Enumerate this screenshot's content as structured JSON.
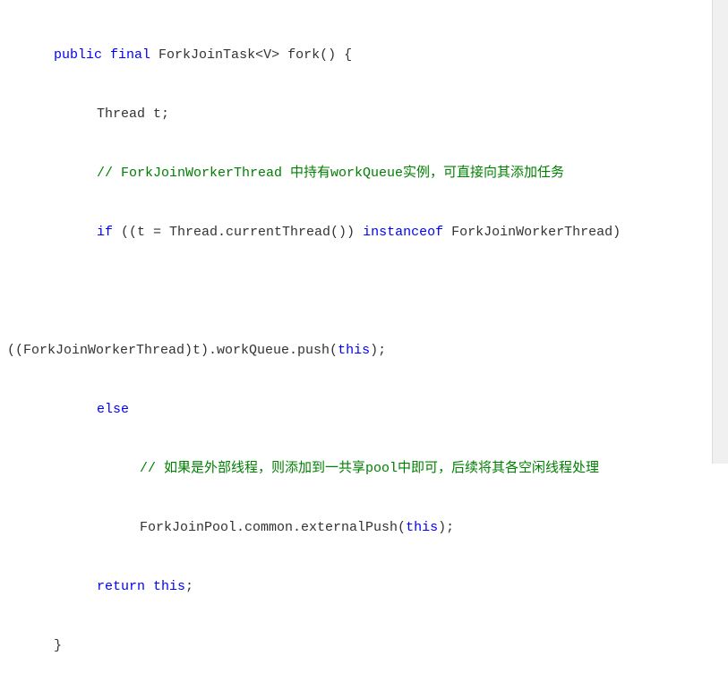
{
  "code": {
    "line1": {
      "kw1": "public",
      "kw2": "final",
      "sig": " ForkJoinTask<V> fork() {"
    },
    "line2": "Thread t;",
    "line3_comment": "// ForkJoinWorkerThread 中持有workQueue实例，可直接向其添加任务",
    "line4": {
      "kw_if": "if",
      "part1": " ((t = Thread.currentThread()) ",
      "kw_inst": "instanceof",
      "wrap": "ForkJoinWorkerThread)"
    },
    "line5_blank": "",
    "line6": "((ForkJoinWorkerThread)t).workQueue.push(",
    "line6_this": "this",
    "line6_end": ");",
    "line7_else": "else",
    "line8_comment": "// 如果是外部线程，则添加到一共享pool中即可，后续将其各空闲线程处理",
    "line9": "ForkJoinPool.common.externalPush(",
    "line9_this": "this",
    "line9_end": ");",
    "line10_return": "return",
    "line10_this": " this",
    "line10_end": ";",
    "line11": "}"
  }
}
